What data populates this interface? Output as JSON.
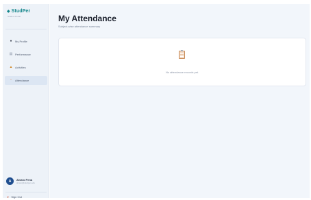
{
  "brand": {
    "name": "StudPer",
    "tagline": "Student Portal"
  },
  "sidebar": {
    "items": [
      {
        "label": "My Profile",
        "icon": "person-icon",
        "active": false
      },
      {
        "label": "Performance",
        "icon": "chart-icon",
        "active": false
      },
      {
        "label": "Activities",
        "icon": "trophy-icon",
        "active": false
      },
      {
        "label": "Attendance",
        "icon": "calendar-icon",
        "active": true
      }
    ]
  },
  "user": {
    "initial": "A",
    "name": "Alvaro Pena",
    "email": "alvaro@studper.edu"
  },
  "signout": {
    "label": "Sign Out"
  },
  "page": {
    "title": "My Attendance",
    "subtitle": "Subject-wise attendance summary",
    "empty_message": "No attendance records yet."
  },
  "colors": {
    "accent": "#12858a",
    "sidebar_bg": "#edf2f8",
    "main_bg": "#f2f6fb",
    "avatar": "#1f4e8f"
  }
}
